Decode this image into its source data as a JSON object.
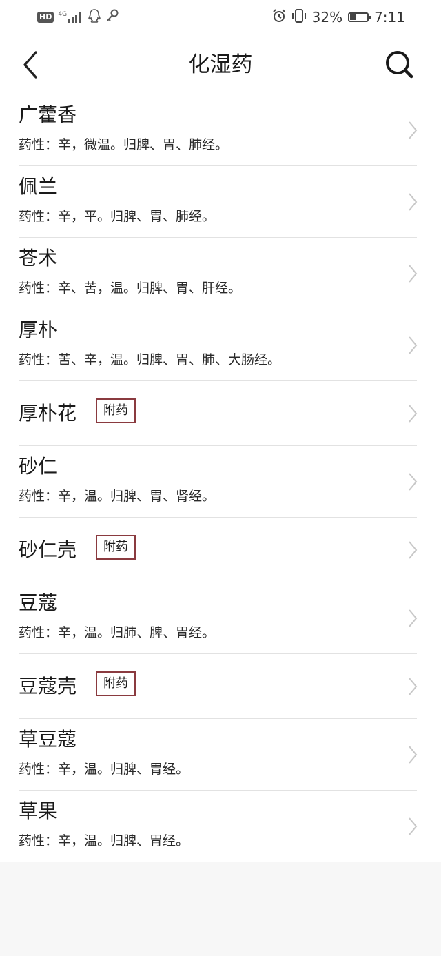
{
  "status_bar": {
    "hd_badge": "HD",
    "network": "4G",
    "battery_percent": "32%",
    "battery_level": 0.32,
    "time": "7:11",
    "icons": [
      "signal-icon",
      "qq-icon",
      "key-icon",
      "alarm-icon",
      "vibrate-icon",
      "battery-icon"
    ]
  },
  "header": {
    "title": "化湿药",
    "back_icon": "chevron-left-icon",
    "search_icon": "search-icon"
  },
  "colors": {
    "tag_border": "#8a3a3f",
    "divider": "#e2e2e2",
    "chevron": "#c8c8c8"
  },
  "items": [
    {
      "name": "广藿香",
      "desc": "药性：辛，微温。归脾、胃、肺经。"
    },
    {
      "name": "佩兰",
      "desc": "药性：辛，平。归脾、胃、肺经。"
    },
    {
      "name": "苍术",
      "desc": "药性：辛、苦，温。归脾、胃、肝经。"
    },
    {
      "name": "厚朴",
      "desc": "药性：苦、辛，温。归脾、胃、肺、大肠经。"
    },
    {
      "name": "厚朴花",
      "tag": "附药"
    },
    {
      "name": "砂仁",
      "desc": "药性：辛，温。归脾、胃、肾经。"
    },
    {
      "name": "砂仁壳",
      "tag": "附药"
    },
    {
      "name": "豆蔻",
      "desc": "药性：辛，温。归肺、脾、胃经。"
    },
    {
      "name": "豆蔻壳",
      "tag": "附药"
    },
    {
      "name": "草豆蔻",
      "desc": "药性：辛，温。归脾、胃经。"
    },
    {
      "name": "草果",
      "desc": "药性：辛，温。归脾、胃经。"
    }
  ]
}
